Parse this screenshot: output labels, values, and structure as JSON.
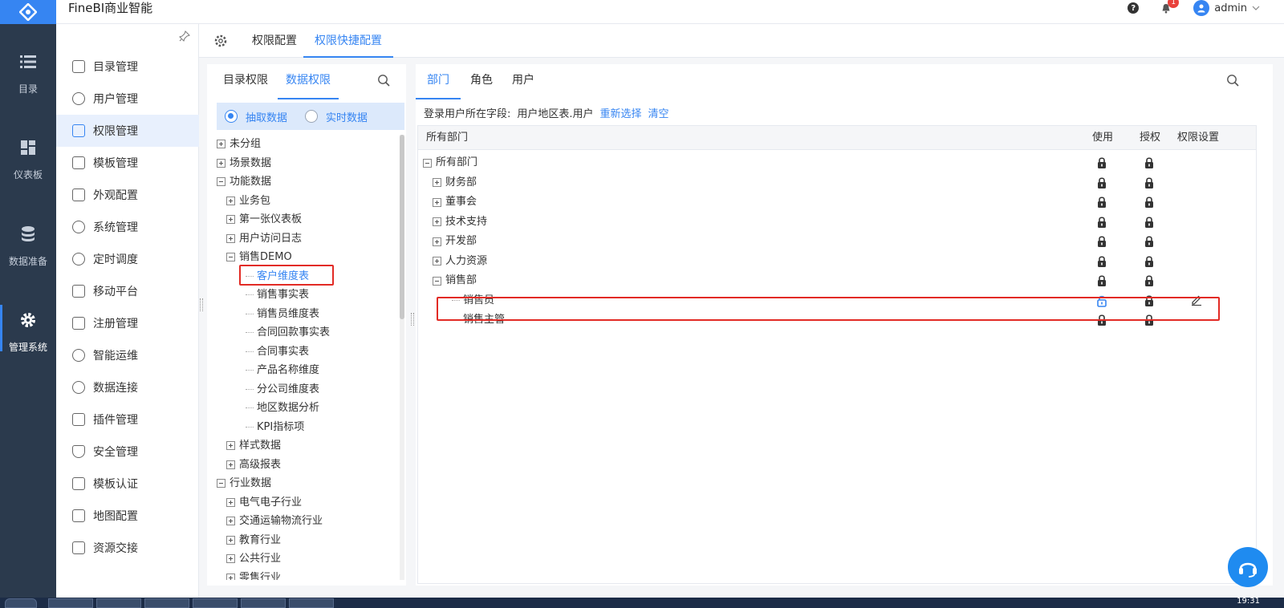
{
  "header": {
    "app_title": "FineBI商业智能",
    "notification_count": "1",
    "user_name": "admin"
  },
  "left_nav": [
    {
      "label": "目录",
      "icon": "list-icon"
    },
    {
      "label": "仪表板",
      "icon": "dashboard-icon"
    },
    {
      "label": "数据准备",
      "icon": "database-icon"
    },
    {
      "label": "管理系统",
      "icon": "gear-icon",
      "active": true
    }
  ],
  "sidebar": {
    "items": [
      {
        "label": "目录管理",
        "icon": "catalog-icon"
      },
      {
        "label": "用户管理",
        "icon": "user-icon"
      },
      {
        "label": "权限管理",
        "icon": "lock-icon",
        "active": true
      },
      {
        "label": "模板管理",
        "icon": "template-icon"
      },
      {
        "label": "外观配置",
        "icon": "brush-icon"
      },
      {
        "label": "系统管理",
        "icon": "settings-icon"
      },
      {
        "label": "定时调度",
        "icon": "timer-icon"
      },
      {
        "label": "移动平台",
        "icon": "mobile-icon"
      },
      {
        "label": "注册管理",
        "icon": "register-icon"
      },
      {
        "label": "智能运维",
        "icon": "ops-icon"
      },
      {
        "label": "数据连接",
        "icon": "link-icon"
      },
      {
        "label": "插件管理",
        "icon": "plugin-icon"
      },
      {
        "label": "安全管理",
        "icon": "shield-icon"
      },
      {
        "label": "模板认证",
        "icon": "cert-icon"
      },
      {
        "label": "地图配置",
        "icon": "map-icon"
      },
      {
        "label": "资源交接",
        "icon": "transfer-icon"
      }
    ]
  },
  "main_tabs": {
    "tab1": "权限配置",
    "tab2": "权限快捷配置"
  },
  "left_panel": {
    "tab_catalog": "目录权限",
    "tab_data": "数据权限",
    "radio_extract": "抽取数据",
    "radio_realtime": "实时数据",
    "tree": [
      {
        "label": "未分组",
        "level": 0,
        "type": "plus"
      },
      {
        "label": "场景数据",
        "level": 0,
        "type": "plus"
      },
      {
        "label": "功能数据",
        "level": 0,
        "type": "minus"
      },
      {
        "label": "业务包",
        "level": 1,
        "type": "plus"
      },
      {
        "label": "第一张仪表板",
        "level": 1,
        "type": "plus"
      },
      {
        "label": "用户访问日志",
        "level": 1,
        "type": "plus"
      },
      {
        "label": "销售DEMO",
        "level": 1,
        "type": "minus"
      },
      {
        "label": "客户维度表",
        "level": 2,
        "type": "leaf",
        "selected": true
      },
      {
        "label": "销售事实表",
        "level": 2,
        "type": "leaf"
      },
      {
        "label": "销售员维度表",
        "level": 2,
        "type": "leaf"
      },
      {
        "label": "合同回款事实表",
        "level": 2,
        "type": "leaf"
      },
      {
        "label": "合同事实表",
        "level": 2,
        "type": "leaf"
      },
      {
        "label": "产品名称维度",
        "level": 2,
        "type": "leaf"
      },
      {
        "label": "分公司维度表",
        "level": 2,
        "type": "leaf"
      },
      {
        "label": "地区数据分析",
        "level": 2,
        "type": "leaf"
      },
      {
        "label": "KPI指标项",
        "level": 2,
        "type": "leaf"
      },
      {
        "label": "样式数据",
        "level": 1,
        "type": "plus"
      },
      {
        "label": "高级报表",
        "level": 1,
        "type": "plus"
      },
      {
        "label": "行业数据",
        "level": 0,
        "type": "minus"
      },
      {
        "label": "电气电子行业",
        "level": 1,
        "type": "plus"
      },
      {
        "label": "交通运输物流行业",
        "level": 1,
        "type": "plus"
      },
      {
        "label": "教育行业",
        "level": 1,
        "type": "plus"
      },
      {
        "label": "公共行业",
        "level": 1,
        "type": "plus"
      },
      {
        "label": "零售行业",
        "level": 1,
        "type": "plus"
      }
    ]
  },
  "right_panel": {
    "tab_dept": "部门",
    "tab_role": "角色",
    "tab_user": "用户",
    "login_label": "登录用户所在字段:",
    "login_value": "用户地区表.用户",
    "reselect": "重新选择",
    "clear": "清空",
    "col_all": "所有部门",
    "col_use": "使用",
    "col_auth": "授权",
    "col_setting": "权限设置",
    "rows": [
      {
        "label": "所有部门",
        "level": 0,
        "type": "minus",
        "use": "locked",
        "auth": "locked"
      },
      {
        "label": "财务部",
        "level": 1,
        "type": "plus",
        "use": "locked",
        "auth": "locked"
      },
      {
        "label": "董事会",
        "level": 1,
        "type": "plus",
        "use": "locked",
        "auth": "locked"
      },
      {
        "label": "技术支持",
        "level": 1,
        "type": "plus",
        "use": "locked",
        "auth": "locked"
      },
      {
        "label": "开发部",
        "level": 1,
        "type": "plus",
        "use": "locked",
        "auth": "locked"
      },
      {
        "label": "人力资源",
        "level": 1,
        "type": "plus",
        "use": "locked",
        "auth": "locked"
      },
      {
        "label": "销售部",
        "level": 1,
        "type": "minus",
        "use": "locked",
        "auth": "locked"
      },
      {
        "label": "销售员",
        "level": 2,
        "type": "leaf",
        "use": "unlocked",
        "auth": "locked",
        "edit": true
      },
      {
        "label": "销售主管",
        "level": 2,
        "type": "leaf",
        "use": "locked",
        "auth": "locked"
      }
    ]
  },
  "taskbar": {
    "clock": "19:31"
  },
  "colors": {
    "accent": "#3685f2",
    "nav_bg": "#2b3a4d",
    "highlight_box": "#e22b25"
  }
}
